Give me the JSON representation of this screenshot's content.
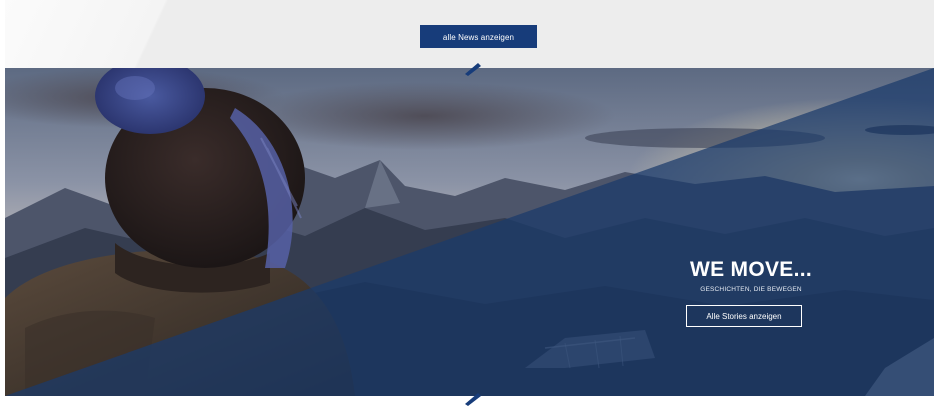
{
  "news_section": {
    "button_label": "alle News anzeigen"
  },
  "hero": {
    "title": "WE MOVE...",
    "subtitle": "GESCHICHTEN, DIE BEWEGEN",
    "button_label": "Alle Stories anzeigen"
  },
  "colors": {
    "brand_blue": "#173c7a",
    "top_strip": "#ededed",
    "overlay_blue": "#1b3a6b"
  },
  "icons": {
    "top_marker": "slash-marker-icon",
    "bottom_marker": "slash-marker-icon"
  }
}
